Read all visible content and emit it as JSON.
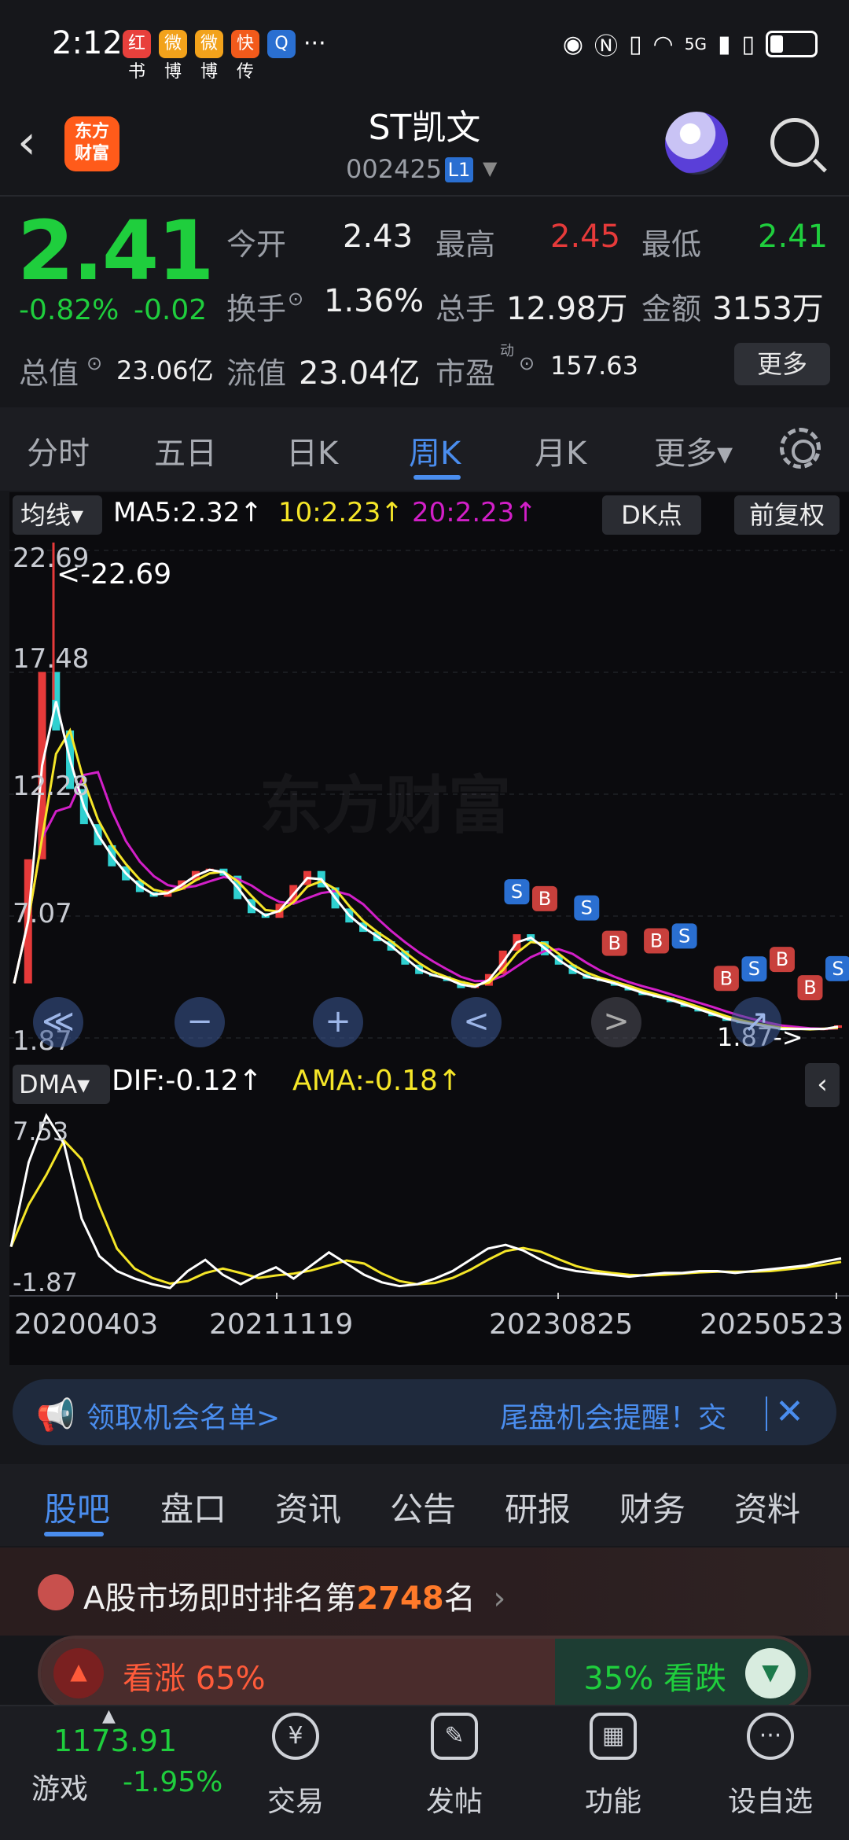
{
  "status_bar": {
    "time": "2:12",
    "more": "···",
    "network": "5G",
    "apps": [
      "红书",
      "微博",
      "微博",
      "快传",
      "Q"
    ]
  },
  "header": {
    "stock_name": "ST凯文",
    "stock_code": "002425",
    "level_badge": "L1",
    "logo_line1": "东方",
    "logo_line2": "财富"
  },
  "quote": {
    "price": "2.41",
    "change_pct": "-0.82%",
    "change_amt": "-0.02",
    "open_label": "今开",
    "open": "2.43",
    "high_label": "最高",
    "high": "2.45",
    "low_label": "最低",
    "low": "2.41",
    "turnover_label": "换手",
    "turnover": "1.36%",
    "volume_label": "总手",
    "volume": "12.98万",
    "amount_label": "金额",
    "amount": "3153万",
    "mktcap_label": "总值",
    "mktcap": "23.06亿",
    "float_label": "流值",
    "float_cap": "23.04亿",
    "pe_label": "市盈",
    "pe_sup": "动",
    "pe": "157.63",
    "more_button": "更多"
  },
  "period_tabs": [
    "分时",
    "五日",
    "日K",
    "周K",
    "月K",
    "更多▾"
  ],
  "chart": {
    "ma_select": "均线▾",
    "ma5": "MA5:2.32↑",
    "ma10": "10:2.23↑",
    "ma20": "20:2.23↑",
    "dk_button": "DK点",
    "adjust_button": "前复权",
    "y_ticks": [
      "22.69",
      "17.48",
      "12.28",
      "7.07",
      "1.87"
    ],
    "max_label": "<-22.69",
    "min_label": "1.87->",
    "dma_select": "DMA▾",
    "dif": "DIF:-0.12↑",
    "ama": "AMA:-0.18↑",
    "dma_ticks": [
      "7.53",
      "-1.87"
    ],
    "x_dates": [
      "20200403",
      "20211119",
      "20230825",
      "20250523"
    ],
    "colors": {
      "ma5": "#ffffff",
      "ma10": "#f5e628",
      "ma20": "#d21fc8",
      "up": "#e63a3a",
      "down": "#2fd0d0"
    },
    "price_series": [
      4.2,
      9.5,
      17.5,
      15.0,
      12.5,
      11.0,
      10.1,
      9.2,
      8.6,
      8.1,
      7.9,
      8.2,
      8.6,
      9.0,
      9.1,
      8.8,
      7.8,
      7.2,
      7.0,
      7.6,
      8.4,
      9.0,
      8.3,
      7.4,
      6.8,
      6.4,
      6.0,
      5.6,
      5.0,
      4.6,
      4.5,
      4.3,
      4.0,
      4.1,
      4.6,
      5.6,
      6.3,
      6.0,
      5.4,
      5.0,
      4.6,
      4.4,
      4.3,
      4.1,
      3.9,
      3.7,
      3.6,
      3.4,
      3.2,
      3.0,
      2.8,
      2.6,
      2.5,
      2.4,
      2.3,
      2.2,
      2.3,
      2.2,
      2.3,
      2.41
    ],
    "dma_series": [
      0.5,
      5.0,
      7.5,
      6.0,
      2.0,
      0.0,
      -0.8,
      -1.2,
      -1.5,
      -1.7,
      -0.8,
      -0.2,
      -1.0,
      -1.5,
      -1.0,
      -0.6,
      -1.2,
      -0.5,
      0.2,
      -0.4,
      -1.0,
      -1.4,
      -1.6,
      -1.5,
      -1.2,
      -0.8,
      -0.2,
      0.4,
      0.6,
      0.3,
      -0.2,
      -0.6,
      -0.8,
      -0.9,
      -1.0,
      -1.1,
      -1.0,
      -0.9,
      -0.9,
      -0.8,
      -0.8,
      -0.9,
      -0.8,
      -0.7,
      -0.6,
      -0.5,
      -0.3,
      -0.12
    ]
  },
  "nav_buttons": [
    "≪",
    "−",
    "+",
    "<",
    ">",
    "↗"
  ],
  "ad": {
    "left_text": "领取机会名单>",
    "right_text": "尾盘机会提醒！交",
    "close": "✕"
  },
  "content_tabs": [
    "股吧",
    "盘口",
    "资讯",
    "公告",
    "研报",
    "财务",
    "资料"
  ],
  "rank": {
    "prefix": "A股市场即时排名第",
    "number": "2748",
    "suffix": "名",
    "chevron": "›"
  },
  "vote": {
    "up_label": "看涨 65%",
    "down_label": "35% 看跌",
    "up_pct": 65,
    "down_pct": 35
  },
  "bottom_nav": {
    "index_value": "1173.91",
    "index_name": "游戏",
    "index_change": "-1.95%",
    "items": [
      "交易",
      "发帖",
      "功能",
      "设自选"
    ]
  }
}
